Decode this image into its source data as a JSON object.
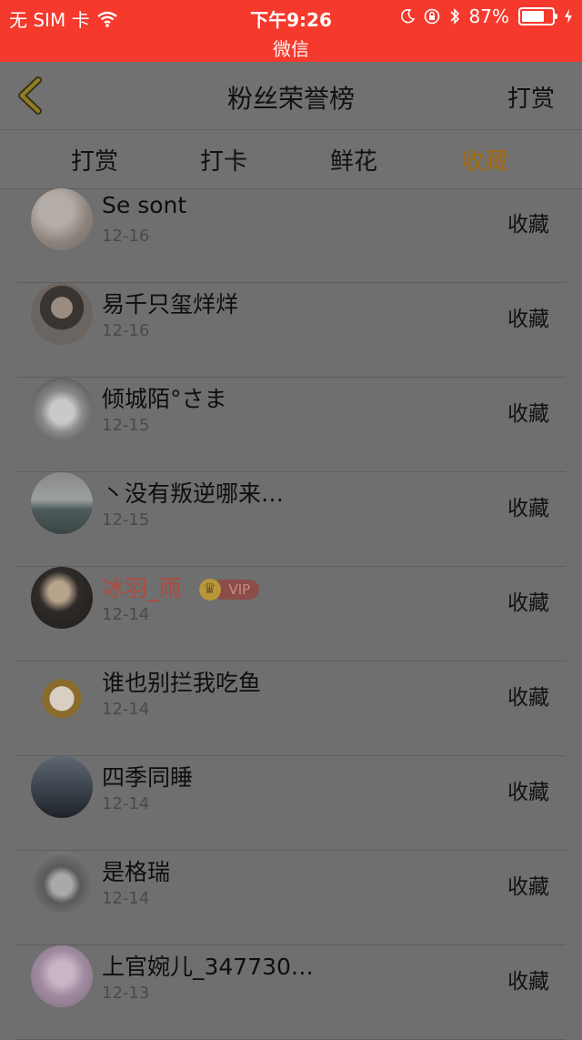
{
  "status_bar": {
    "carrier": "无 SIM 卡",
    "time": "下午9:26",
    "app_name": "微信",
    "battery": "87%",
    "battery_level": 0.87
  },
  "nav": {
    "title": "粉丝荣誉榜",
    "right_action": "打赏"
  },
  "tabs": [
    {
      "label": "打赏",
      "active": false
    },
    {
      "label": "打卡",
      "active": false
    },
    {
      "label": "鲜花",
      "active": false
    },
    {
      "label": "收藏",
      "active": true
    }
  ],
  "rows": [
    {
      "name": "Se sont",
      "date": "12-16",
      "action": "收藏"
    },
    {
      "name": "易千只玺烊烊",
      "date": "12-16",
      "action": "收藏"
    },
    {
      "name": "倾城陌°さま",
      "date": "12-15",
      "action": "收藏"
    },
    {
      "name": "丶没有叛逆哪来…",
      "date": "12-15",
      "action": "收藏"
    },
    {
      "name": "冰羽_雨",
      "date": "12-14",
      "action": "收藏",
      "vip": "VIP"
    },
    {
      "name": "谁也别拦我吃鱼",
      "date": "12-14",
      "action": "收藏"
    },
    {
      "name": "四季同睡",
      "date": "12-14",
      "action": "收藏"
    },
    {
      "name": "是格瑞",
      "date": "12-14",
      "action": "收藏"
    },
    {
      "name": "上官婉儿_347730…",
      "date": "12-13",
      "action": "收藏"
    }
  ],
  "colors": {
    "status_bar": "#f5392d",
    "active_tab": "#a66a10",
    "vip_name": "#b24a3b"
  }
}
